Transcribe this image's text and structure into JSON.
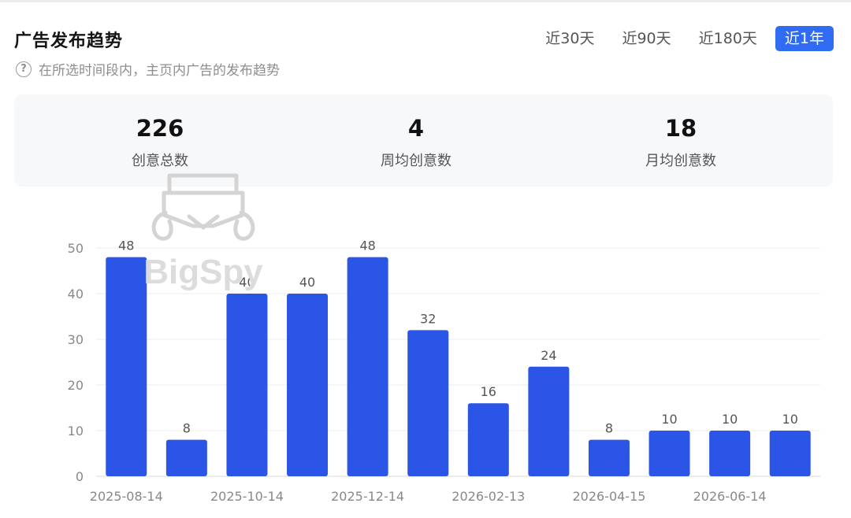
{
  "header": {
    "title": "广告发布趋势",
    "subtitle": "在所选时间段内，主页内广告的发布趋势",
    "tabs": [
      {
        "label": "近30天",
        "active": false
      },
      {
        "label": "近90天",
        "active": false
      },
      {
        "label": "近180天",
        "active": false
      },
      {
        "label": "近1年",
        "active": true
      }
    ]
  },
  "stats": [
    {
      "value": "226",
      "label": "创意总数"
    },
    {
      "value": "4",
      "label": "周均创意数"
    },
    {
      "value": "18",
      "label": "月均创意数"
    }
  ],
  "watermark": {
    "text": "BigSpy"
  },
  "colors": {
    "bar": "#2b55e6",
    "accent": "#2f6bf3"
  },
  "chart_data": {
    "type": "bar",
    "values": [
      48,
      8,
      40,
      40,
      48,
      32,
      16,
      24,
      8,
      10,
      10,
      10
    ],
    "x_tick_labels": [
      "2025-08-14",
      "2025-10-14",
      "2025-12-14",
      "2026-02-13",
      "2026-04-15",
      "2026-06-14"
    ],
    "y_ticks": [
      0,
      10,
      20,
      30,
      40,
      50
    ],
    "ylim": [
      0,
      50
    ],
    "data_labels": true,
    "grid": true,
    "legend": "none"
  }
}
